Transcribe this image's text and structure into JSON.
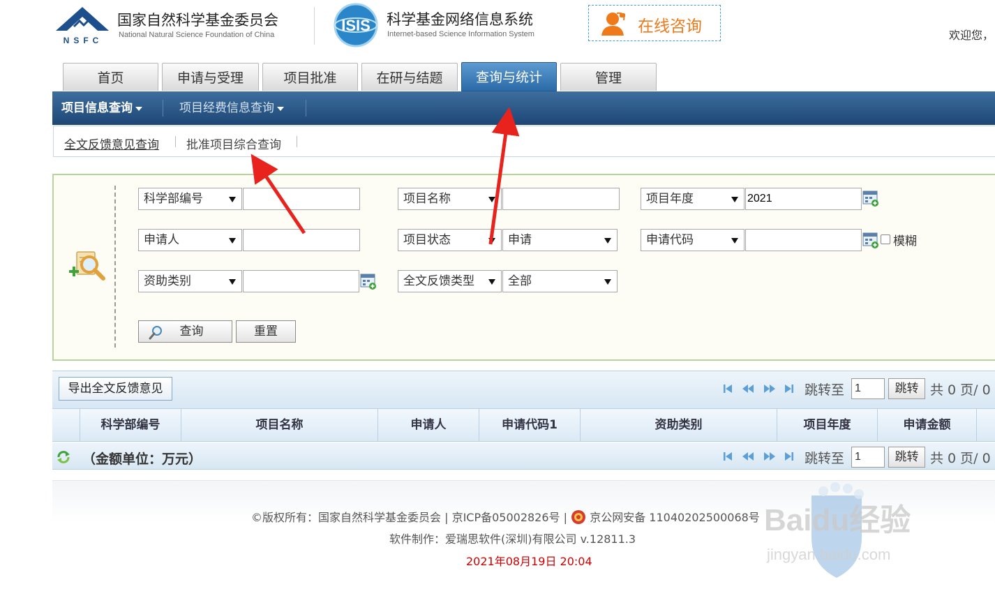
{
  "header": {
    "org_cn": "国家自然科学基金委员会",
    "org_en": "National Natural Science Foundation of China",
    "logo_text": "NSFC",
    "system_cn": "科学基金网络信息系统",
    "system_en": "Internet-based Science Information System",
    "system_logo_text": "ISIS",
    "consult_label": "在线咨询",
    "welcome": "欢迎您，"
  },
  "tabs": [
    {
      "label": "首页"
    },
    {
      "label": "申请与受理"
    },
    {
      "label": "项目批准"
    },
    {
      "label": "在研与结题"
    },
    {
      "label": "查询与统计",
      "active": true
    },
    {
      "label": "管理"
    }
  ],
  "nav": {
    "items": [
      {
        "label": "项目信息查询",
        "active": true
      },
      {
        "label": "项目经费信息查询"
      }
    ]
  },
  "subnav": {
    "items": [
      {
        "label": "全文反馈意见查询",
        "active": true
      },
      {
        "label": "批准项目综合查询"
      }
    ]
  },
  "search": {
    "row1": {
      "f1": {
        "field": "科学部编号",
        "value": ""
      },
      "f2": {
        "field": "项目名称",
        "value": ""
      },
      "f3": {
        "field": "项目年度",
        "value": "2021"
      }
    },
    "row2": {
      "f1": {
        "field": "申请人",
        "value": ""
      },
      "f2": {
        "field": "项目状态",
        "value": "申请"
      },
      "f3": {
        "field": "申请代码",
        "value": ""
      },
      "fuzzy_label": "模糊"
    },
    "row3": {
      "f1": {
        "field": "资助类别",
        "value": ""
      },
      "f2": {
        "field": "全文反馈类型",
        "value": "全部"
      }
    },
    "query_button": "查询",
    "reset_button": "重置"
  },
  "grid": {
    "export_button": "导出全文反馈意见",
    "pager": {
      "jump_label": "跳转至",
      "page_value": "1",
      "go_button": "跳转",
      "total_text": "共 0 页/ 0"
    },
    "columns": [
      "科学部编号",
      "项目名称",
      "申请人",
      "申请代码1",
      "资助类别",
      "项目年度",
      "申请金额"
    ],
    "unit_note": "（金额单位：万元）"
  },
  "footer": {
    "copyright_prefix": "©版权所有：国家自然科学基金委员会 | 京ICP备05002826号 | ",
    "police_record": "京公网安备 11040202500068号",
    "software": "软件制作：爱瑞思软件(深圳)有限公司 v.12811.3",
    "datetime": "2021年08月19日 20:04"
  },
  "watermark": {
    "text": "Baidu经验",
    "sub": "jingyan.baidu.com"
  },
  "colors": {
    "nav_dark": "#1d4675",
    "tab_active": "#2a6aa8",
    "consult_orange": "#f07a1a",
    "panel_border": "#b7d59a",
    "annotation_red": "#e8221c",
    "datetime_red": "#cc0000"
  }
}
